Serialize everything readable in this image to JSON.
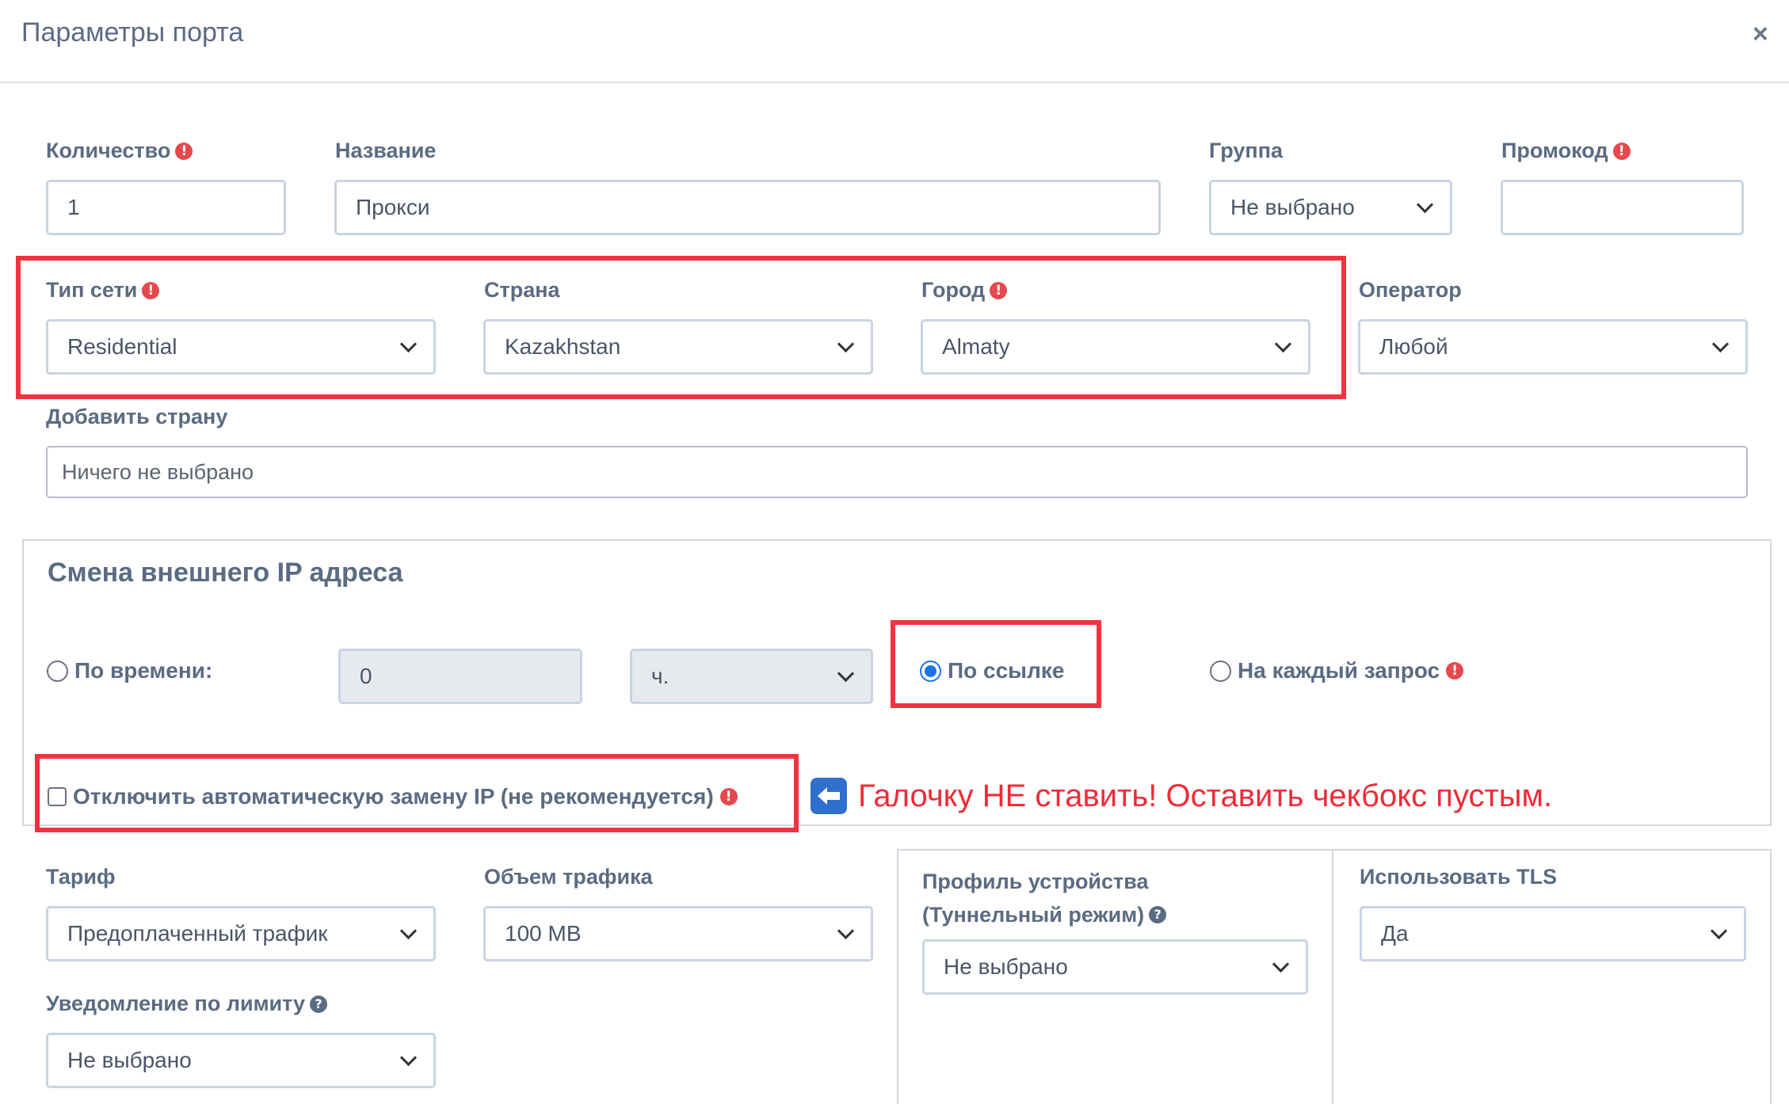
{
  "dialog": {
    "title": "Параметры порта",
    "close": "×"
  },
  "fields": {
    "quantity": {
      "label": "Количество",
      "value": "1"
    },
    "name": {
      "label": "Название",
      "value": "Прокси"
    },
    "group": {
      "label": "Группа",
      "value": "Не выбрано"
    },
    "promo": {
      "label": "Промокод",
      "value": ""
    },
    "network_type": {
      "label": "Тип сети",
      "value": "Residential"
    },
    "country": {
      "label": "Страна",
      "value": "Kazakhstan"
    },
    "city": {
      "label": "Город",
      "value": "Almaty"
    },
    "operator": {
      "label": "Оператор",
      "value": "Любой"
    },
    "add_country": {
      "label": "Добавить страну",
      "value": "Ничего не выбрано"
    }
  },
  "ip_change": {
    "title": "Смена внешнего IP адреса",
    "by_time_label": "По времени:",
    "time_value": "0",
    "time_unit": "ч.",
    "by_link_label": "По ссылке",
    "each_request_label": "На каждый запрос",
    "selected": "by_link",
    "disable_auto_label": "Отключить автоматическую замену IP (не рекомендуется)",
    "disable_auto_checked": false
  },
  "annotation": {
    "text": "Галочку НЕ ставить! Оставить чекбокс пустым."
  },
  "tariff": {
    "label": "Тариф",
    "value": "Предоплаченный трафик"
  },
  "traffic": {
    "label": "Объем трафика",
    "value": "100 MB"
  },
  "device_profile": {
    "label_line1": "Профиль устройства",
    "label_line2": "(Туннельный режим)",
    "value": "Не выбрано"
  },
  "tls": {
    "label": "Использовать TLS",
    "value": "Да"
  },
  "limit_notice": {
    "label": "Уведомление по лимиту",
    "value": "Не выбрано"
  },
  "icons": {
    "required": "!",
    "help": "?"
  },
  "colors": {
    "highlight": "#f23240",
    "accent": "#1a73e8",
    "label": "#5a6b82"
  }
}
